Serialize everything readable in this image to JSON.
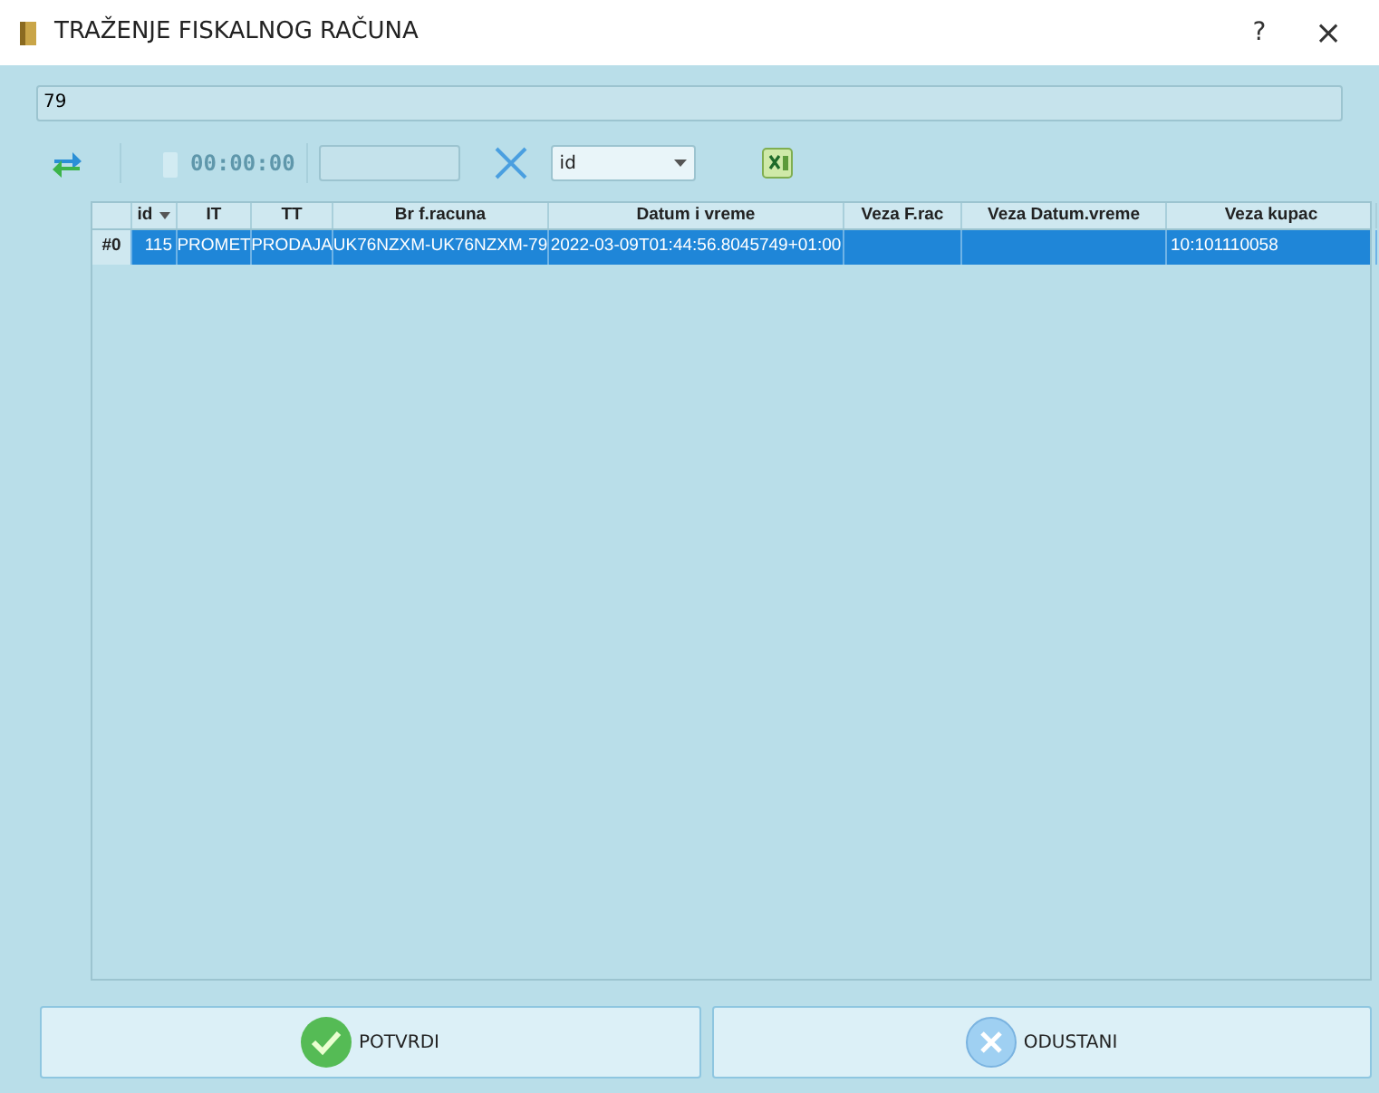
{
  "window": {
    "title": "TRAŽENJE FISKALNOG RAČUNA",
    "help": "?",
    "close": "×"
  },
  "search": {
    "value": "79"
  },
  "toolbar": {
    "time": "00:00:00",
    "field_select": "id"
  },
  "table": {
    "columns": [
      {
        "sorted": false
      },
      {
        "label": "id",
        "sorted": true
      },
      {
        "label": "IT",
        "sorted": false
      },
      {
        "label": "TT",
        "sorted": false
      },
      {
        "label": "Br f.racuna",
        "sorted": false
      },
      {
        "label": "Datum i vreme",
        "sorted": false
      },
      {
        "label": "Veza F.rac",
        "sorted": false
      },
      {
        "label": "Veza Datum.vreme",
        "sorted": false
      },
      {
        "label": "Veza kupac",
        "sorted": false
      }
    ],
    "rows": [
      {
        "selected": true,
        "cells": [
          "#0",
          "115",
          "PROMET",
          "PRODAJA",
          "UK76NZXM-UK76NZXM-79",
          "2022-03-09T01:44:56.8045749+01:00",
          "",
          "",
          "10:101110058"
        ]
      }
    ]
  },
  "buttons": [
    {
      "kind": "confirm",
      "label": "POTVRDI"
    },
    {
      "kind": "cancel",
      "label": "ODUSTANI"
    }
  ]
}
